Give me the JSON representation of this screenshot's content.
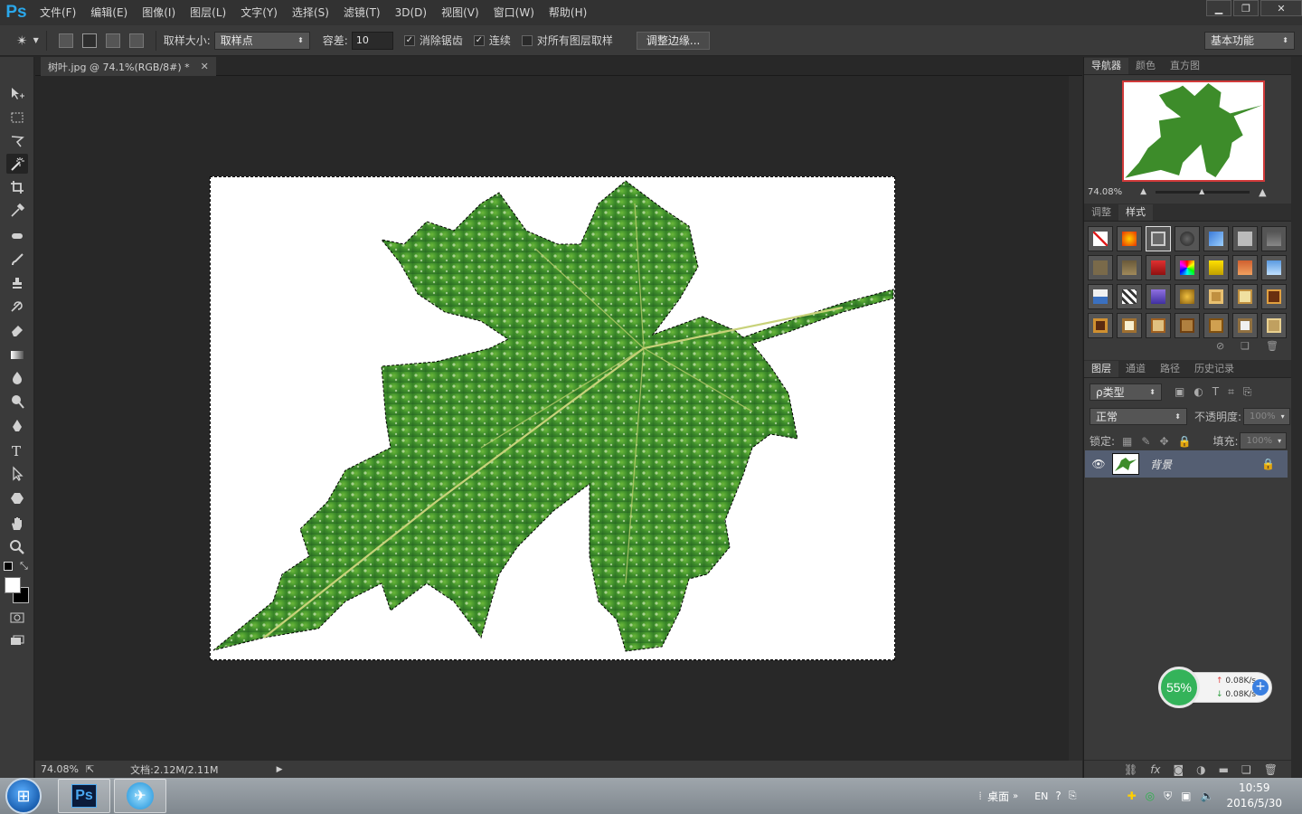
{
  "app": {
    "logo": "Ps"
  },
  "menu": [
    "文件(F)",
    "编辑(E)",
    "图像(I)",
    "图层(L)",
    "文字(Y)",
    "选择(S)",
    "滤镜(T)",
    "3D(D)",
    "视图(V)",
    "窗口(W)",
    "帮助(H)"
  ],
  "options": {
    "sample_size_label": "取样大小:",
    "sample_size_value": "取样点",
    "tolerance_label": "容差:",
    "tolerance_value": "10",
    "anti_alias": "消除锯齿",
    "contiguous": "连续",
    "sample_all_layers": "对所有图层取样",
    "refine_edge": "调整边缘...",
    "workspace": "基本功能",
    "anti_alias_checked": true,
    "contiguous_checked": true,
    "sample_all_layers_checked": false
  },
  "document": {
    "tab_title": "树叶.jpg @ 74.1%(RGB/8#) *"
  },
  "status": {
    "zoom": "74.08%",
    "doc_size": "文档:2.12M/2.11M"
  },
  "panels": {
    "nav_tabs": [
      "导航器",
      "颜色",
      "直方图"
    ],
    "nav_zoom": "74.08%",
    "style_tabs": [
      "调整",
      "样式"
    ],
    "layer_tabs": [
      "图层",
      "通道",
      "路径",
      "历史记录"
    ]
  },
  "layers": {
    "filter": "ρ类型",
    "blend_mode": "正常",
    "opacity_label": "不透明度:",
    "opacity": "100%",
    "lock_label": "锁定:",
    "fill_label": "填充:",
    "fill": "100%",
    "items": [
      {
        "name": "背景",
        "visible": true,
        "locked": true
      }
    ]
  },
  "widget": {
    "percent": "55%",
    "up": "0.08K/s",
    "down": "0.08K/s"
  },
  "taskbar": {
    "ps_label": "Ps",
    "desktop": "桌面",
    "lang": "EN",
    "time": "10:59",
    "date": "2016/5/30"
  },
  "colors": {
    "panel": "#3a3a3a",
    "workspace": "#282828",
    "selected_layer": "#545e72",
    "ps_blue": "#2aa7ea"
  }
}
